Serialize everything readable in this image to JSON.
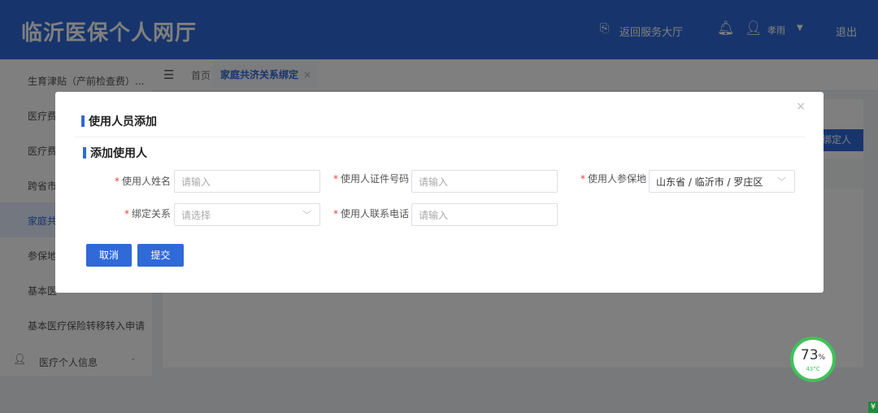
{
  "app": {
    "title": "临沂医保个人网厅"
  },
  "header": {
    "back_hall": "返回服务大厅",
    "user_name": "孝雨",
    "logout": "退出"
  },
  "sidebar": {
    "items": [
      {
        "label": "生育津贴（产前检查费）..."
      },
      {
        "label": "医疗费"
      },
      {
        "label": "医疗费"
      },
      {
        "label": "跨省市"
      },
      {
        "label": "家庭共"
      },
      {
        "label": "参保地"
      },
      {
        "label": "基本医"
      },
      {
        "label": "基本医疗保险转移转入申请"
      }
    ],
    "group": {
      "label": "医疗个人信息"
    }
  },
  "breadcrumb": {
    "home": "首页",
    "tab": "家庭共济关系绑定",
    "tab_close": "×"
  },
  "page": {
    "bind_button": "绑定人"
  },
  "modal": {
    "title": "使用人员添加",
    "close": "×",
    "section_title": "添加使用人",
    "required_mark": "*",
    "fields": {
      "name": {
        "label": "使用人姓名",
        "placeholder": "请输入"
      },
      "id_number": {
        "label": "使用人证件号码",
        "placeholder": "请输入"
      },
      "insured_place": {
        "label": "使用人参保地",
        "value": "山东省 / 临沂市 / 罗庄区"
      },
      "relation": {
        "label": "绑定关系",
        "placeholder": "请选择"
      },
      "phone": {
        "label": "使用人联系电话",
        "placeholder": "请输入"
      }
    },
    "cancel": "取消",
    "submit": "提交"
  },
  "widget": {
    "percent": "73",
    "percent_unit": "%",
    "temperature": "43°C"
  },
  "colors": {
    "primary": "#2f6ad8",
    "required": "#e64340",
    "gauge": "#3cc45a"
  }
}
